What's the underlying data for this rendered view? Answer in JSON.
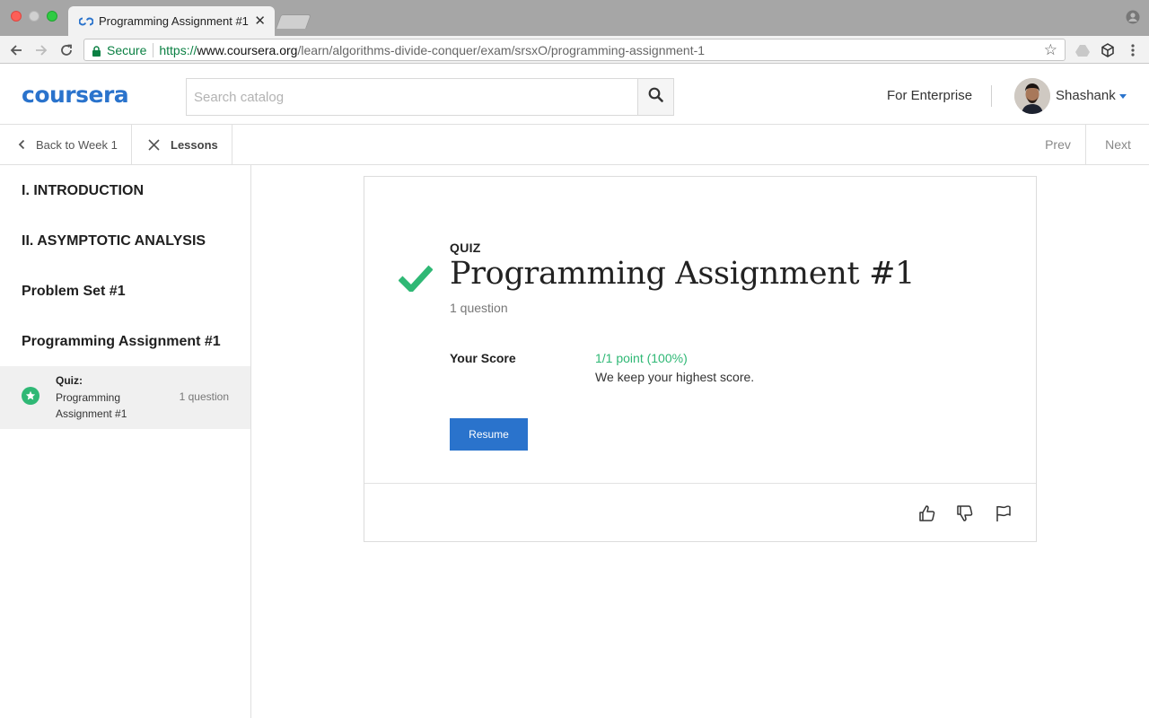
{
  "browser": {
    "tab_title": "Programming Assignment #1",
    "secure_label": "Secure",
    "url_scheme": "https://",
    "url_domain": "www.coursera.org",
    "url_path": "/learn/algorithms-divide-conquer/exam/srsxO/programming-assignment-1"
  },
  "header": {
    "logo": "coursera",
    "search_placeholder": "Search catalog",
    "enterprise_link": "For Enterprise",
    "user_name": "Shashank"
  },
  "lesson_nav": {
    "back_label": "Back to Week 1",
    "lessons_label": "Lessons",
    "prev_label": "Prev",
    "next_label": "Next"
  },
  "sidebar": {
    "sections": [
      {
        "label": "I. INTRODUCTION"
      },
      {
        "label": "II. ASYMPTOTIC ANALYSIS"
      },
      {
        "label": "Problem Set #1"
      },
      {
        "label": "Programming Assignment #1"
      }
    ],
    "active_item": {
      "kind": "Quiz:",
      "title": "Programming Assignment #1",
      "meta": "1 question"
    }
  },
  "main": {
    "kind": "QUIZ",
    "title": "Programming Assignment #1",
    "question_count": "1 question",
    "score_label": "Your Score",
    "score_value": "1/1 point (100%)",
    "score_note": "We keep your highest score.",
    "resume_label": "Resume"
  },
  "colors": {
    "brand_blue": "#2a73cc",
    "success_green": "#2fb875"
  },
  "icons": {
    "feedback": [
      "thumbs-up-icon",
      "thumbs-down-icon",
      "flag-icon"
    ]
  }
}
